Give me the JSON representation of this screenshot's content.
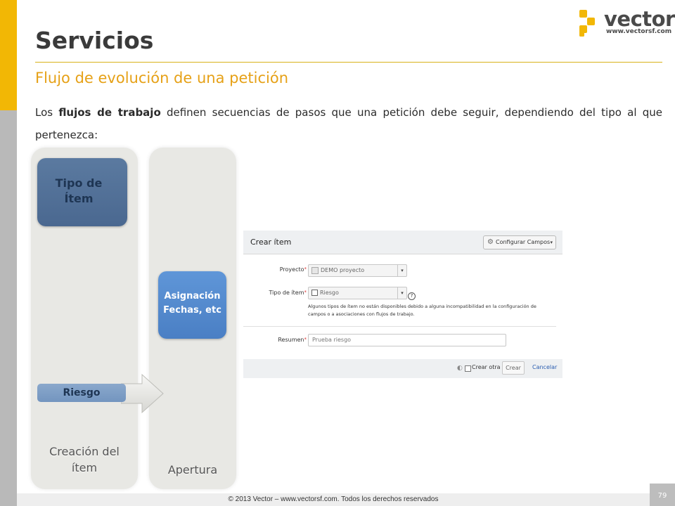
{
  "slide": {
    "title": "Servicios",
    "subtitle": "Flujo de evolución de una petición",
    "paragraph": {
      "part1": "Los ",
      "bold1": "flujos de trabajo",
      "part2": " definen secuencias de pasos que una petición debe seguir, dependiendo del tipo al que pertenezca:"
    },
    "page_number": "79",
    "footer": "© 2013 Vector – www.vectorsf.com. Todos los derechos reservados"
  },
  "logo": {
    "name": "vector",
    "url": "www.vectorsf.com",
    "color": "#f2b705"
  },
  "diagram": {
    "lane1_label_line1": "Creación del",
    "lane1_label_line2": "ítem",
    "lane2_label": "Apertura",
    "box_tipo_line1": "Tipo de",
    "box_tipo_line2": "Ítem",
    "box_asig_line1": "Asignación",
    "box_asig_line2": "Fechas, etc",
    "riesgo": "Riesgo"
  },
  "form": {
    "title": "Crear ítem",
    "config_button": "Configurar Campos",
    "config_icon": "gear-icon",
    "proyecto_label": "Proyecto",
    "proyecto_value": "DEMO proyecto",
    "tipo_label": "Tipo de ítem",
    "tipo_value": "Riesgo",
    "help_glyph": "?",
    "note": "Algunos tipos de ítem no están disponibles debido a alguna incompatibilidad en la configuración de campos o a asociaciones con flujos de trabajo.",
    "resumen_label": "Resumen",
    "resumen_value": "Prueba riesgo",
    "crear_otra": "Crear otra",
    "crear_button": "Crear",
    "cancel_link": "Cancelar",
    "required_mark": "*"
  },
  "colors": {
    "accent_yellow": "#f2b705",
    "subtitle_orange": "#e6a117",
    "box_dark_blue": "#4a6890",
    "box_light_blue": "#4a7fc4"
  }
}
